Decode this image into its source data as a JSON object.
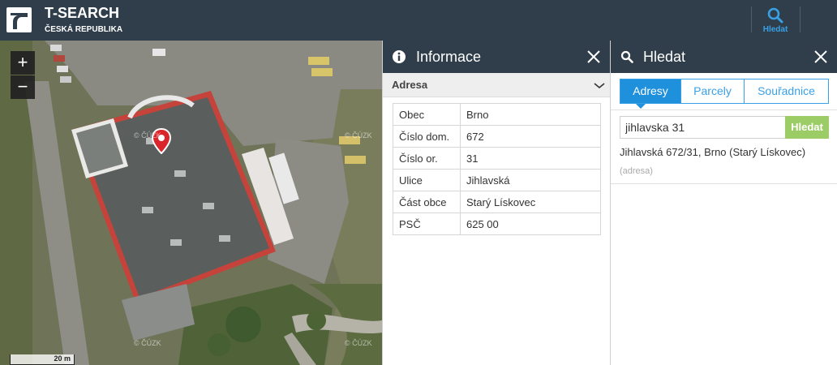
{
  "app": {
    "title": "T-SEARCH",
    "subtitle": "ČESKÁ REPUBLIKA"
  },
  "header": {
    "search_label": "Hledat"
  },
  "map": {
    "zoom_in": "+",
    "zoom_out": "−",
    "scale": "20 m",
    "watermark": "© ČÚZK"
  },
  "info_panel": {
    "title": "Informace",
    "section": "Adresa",
    "rows": [
      {
        "key": "Obec",
        "value": "Brno"
      },
      {
        "key": "Číslo dom.",
        "value": "672"
      },
      {
        "key": "Číslo or.",
        "value": "31"
      },
      {
        "key": "Ulice",
        "value": "Jihlavská"
      },
      {
        "key": "Část obce",
        "value": "Starý Lískovec"
      },
      {
        "key": "PSČ",
        "value": "625 00"
      }
    ]
  },
  "search_panel": {
    "title": "Hledat",
    "tabs": [
      "Adresy",
      "Parcely",
      "Souřadnice"
    ],
    "active_tab": "Adresy",
    "input_value": "jihlavska 31",
    "button": "Hledat",
    "result": {
      "title": "Jihlavská 672/31, Brno (Starý Lískovec)",
      "type": "(adresa)"
    }
  },
  "colors": {
    "header_bg": "#2f3e4a",
    "accent": "#1e90dc",
    "search_button": "#9ccc65",
    "pin": "#d9262a"
  }
}
